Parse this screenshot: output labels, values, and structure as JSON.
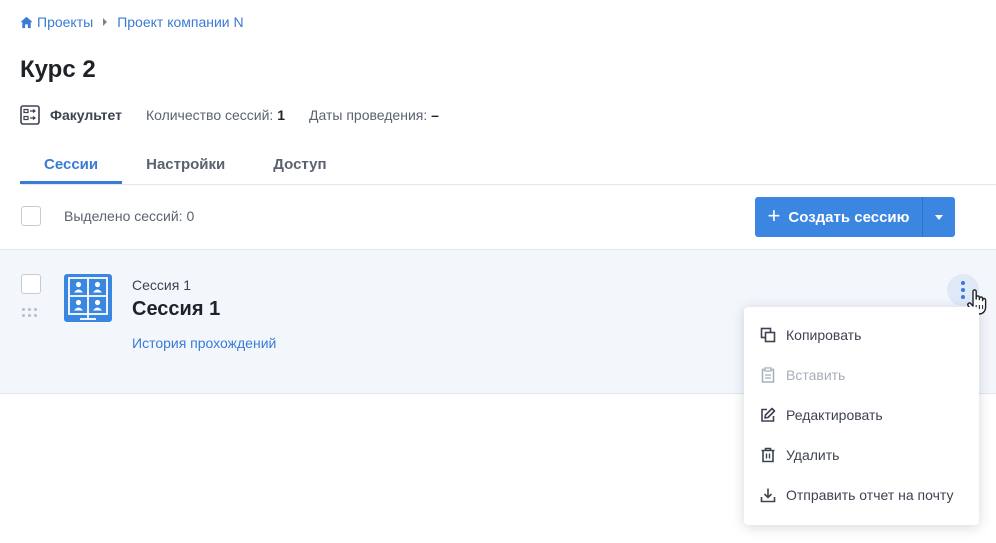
{
  "breadcrumb": {
    "items": [
      "Проекты",
      "Проект компании N"
    ]
  },
  "page": {
    "title": "Курс 2"
  },
  "meta": {
    "faculty": "Факультет",
    "sessions_label": "Количество сессий:",
    "sessions_count": "1",
    "dates_label": "Даты проведения:",
    "dates_value": "–"
  },
  "tabs": [
    {
      "label": "Сессии",
      "active": true
    },
    {
      "label": "Настройки",
      "active": false
    },
    {
      "label": "Доступ",
      "active": false
    }
  ],
  "toolbar": {
    "selected_text": "Выделено сессий: 0",
    "create_label": "Создать сессию"
  },
  "session": {
    "subtitle": "Сессия 1",
    "name": "Сессия 1",
    "history_link": "История прохождений"
  },
  "context_menu": {
    "items": [
      {
        "label": "Копировать",
        "icon": "copy-icon",
        "disabled": false
      },
      {
        "label": "Вставить",
        "icon": "paste-icon",
        "disabled": true
      },
      {
        "label": "Редактировать",
        "icon": "edit-icon",
        "disabled": false
      },
      {
        "label": "Удалить",
        "icon": "trash-icon",
        "disabled": false
      },
      {
        "label": "Отправить отчет на почту",
        "icon": "download-icon",
        "disabled": false
      }
    ]
  },
  "colors": {
    "accent": "#3a86e0",
    "link": "#3a7bd5",
    "row_highlight": "#f3f7fc",
    "text": "#2b2f38",
    "muted": "#5b6270"
  }
}
